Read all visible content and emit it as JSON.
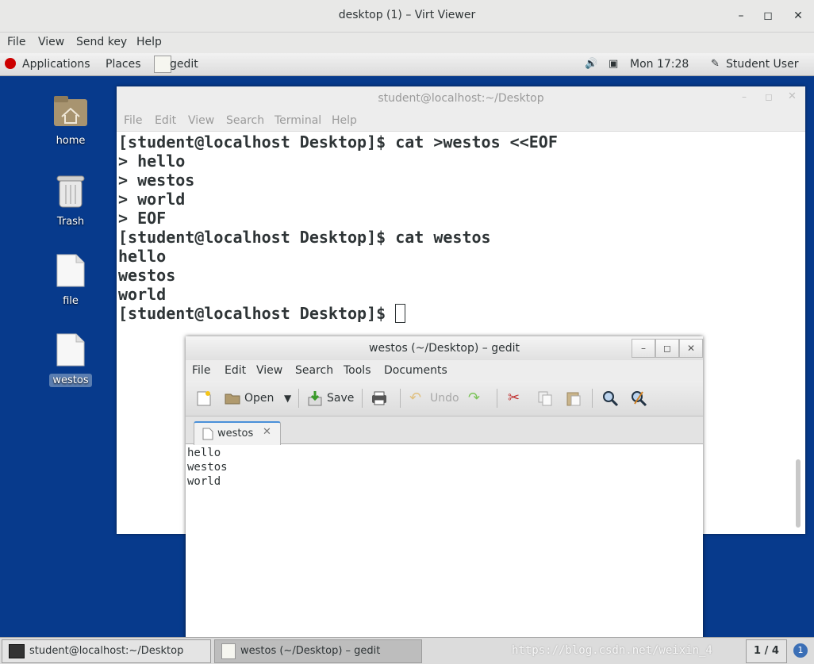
{
  "viewer": {
    "title": "desktop (1) – Virt Viewer",
    "menu": [
      "File",
      "View",
      "Send key",
      "Help"
    ]
  },
  "topbar": {
    "applications": "Applications",
    "places": "Places",
    "active_app": "gedit",
    "clock": "Mon 17:28",
    "user": "Student User"
  },
  "desktop_icons": [
    {
      "label": "home"
    },
    {
      "label": "Trash"
    },
    {
      "label": "file"
    },
    {
      "label": "westos"
    }
  ],
  "terminal": {
    "title": "student@localhost:~/Desktop",
    "menu": [
      "File",
      "Edit",
      "View",
      "Search",
      "Terminal",
      "Help"
    ],
    "lines": [
      "[student@localhost Desktop]$ cat >westos <<EOF",
      "> hello",
      "> westos",
      "> world",
      "> EOF",
      "[student@localhost Desktop]$ cat westos",
      "hello",
      "westos",
      "world",
      "[student@localhost Desktop]$ "
    ]
  },
  "gedit": {
    "title": "westos (~/Desktop) – gedit",
    "menu": [
      "File",
      "Edit",
      "View",
      "Search",
      "Tools",
      "Documents"
    ],
    "toolbar": {
      "open": "Open",
      "save": "Save",
      "undo": "Undo"
    },
    "tab_label": "westos",
    "content": [
      "hello",
      "westos",
      "world"
    ]
  },
  "taskbar": {
    "items": [
      "student@localhost:~/Desktop",
      "westos (~/Desktop) – gedit"
    ],
    "workspace": "1 / 4",
    "watermark": "https://blog.csdn.net/weixin_4"
  },
  "colors": {
    "desktop": "#073a8c",
    "accent": "#4a90d9"
  }
}
